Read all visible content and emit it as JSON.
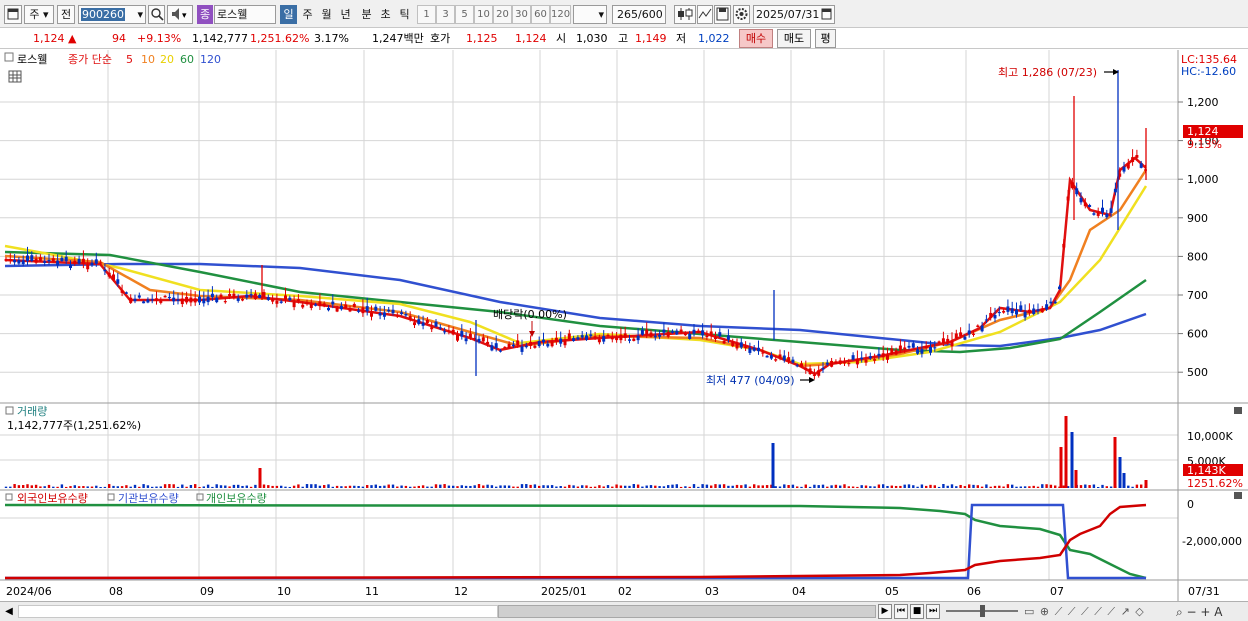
{
  "toolbar": {
    "market": "주",
    "prev_label": "전",
    "code": "900260",
    "badge": "종",
    "stock_name": "로스웰",
    "periods": [
      "일",
      "주",
      "월",
      "년",
      "분",
      "초",
      "틱"
    ],
    "active_period": "일",
    "intervals": [
      "1",
      "3",
      "5",
      "10",
      "20",
      "30",
      "60",
      "120"
    ],
    "bar_count": "265",
    "bar_total": "/600",
    "date": "2025/07/31"
  },
  "quote": {
    "price": "1,124",
    "change": "94",
    "change_pct": "+9.13%",
    "volume": "1,142,777",
    "volume_pct": "1,251.62%",
    "turnover": "3.17%",
    "amount": "1,247백만",
    "hoga_label": "호가",
    "ask": "1,125",
    "bid": "1,124",
    "open_label": "시",
    "open": "1,030",
    "high_label": "고",
    "high": "1,149",
    "low_label": "저",
    "low": "1,022",
    "buy_label": "매수",
    "sell_label": "매도",
    "eval_label": "평"
  },
  "price_panel": {
    "name_tag": "로스웰",
    "ma_title": "종가 단순",
    "ma_periods": [
      "5",
      "10",
      "20",
      "60",
      "120"
    ],
    "lc": "LC:135.64",
    "hc": "HC:-12.60",
    "y_ticks": [
      "1,200",
      "1,100",
      "1,000",
      "900",
      "800",
      "700",
      "600",
      "500"
    ],
    "current_tag": "1,124",
    "current_pct": "9.13%",
    "high_annot": "최고 1,286 (07/23)",
    "low_annot": "최저 477 (04/09)",
    "dividend_annot": "배당락(0.00%)"
  },
  "volume_panel": {
    "title": "거래량",
    "summary": "1,142,777주(1,251.62%)",
    "y_ticks": [
      "10,000K",
      "5,000K"
    ],
    "current_tag": "1,143K",
    "current_pct": "1251.62%"
  },
  "holding_panel": {
    "legend": [
      "외국인보유수량",
      "기관보유수량",
      "개인보유수량"
    ],
    "y_ticks": [
      "0",
      "-2,000,000"
    ]
  },
  "x_axis": {
    "labels": [
      "2024/06",
      "08",
      "09",
      "10",
      "11",
      "12",
      "2025/01",
      "02",
      "03",
      "04",
      "05",
      "06",
      "07"
    ],
    "end_label": "07/31"
  },
  "colors": {
    "ma5": "#e01010",
    "ma10": "#f08020",
    "ma20": "#f0e020",
    "ma60": "#209040",
    "ma120": "#3050d0",
    "up": "#e00000",
    "down": "#0030c0"
  },
  "icons": [
    "window-icon",
    "search-icon",
    "speaker-icon",
    "candle-chart-icon",
    "compare-icon",
    "save-icon",
    "settings-icon",
    "calendar-icon"
  ]
}
